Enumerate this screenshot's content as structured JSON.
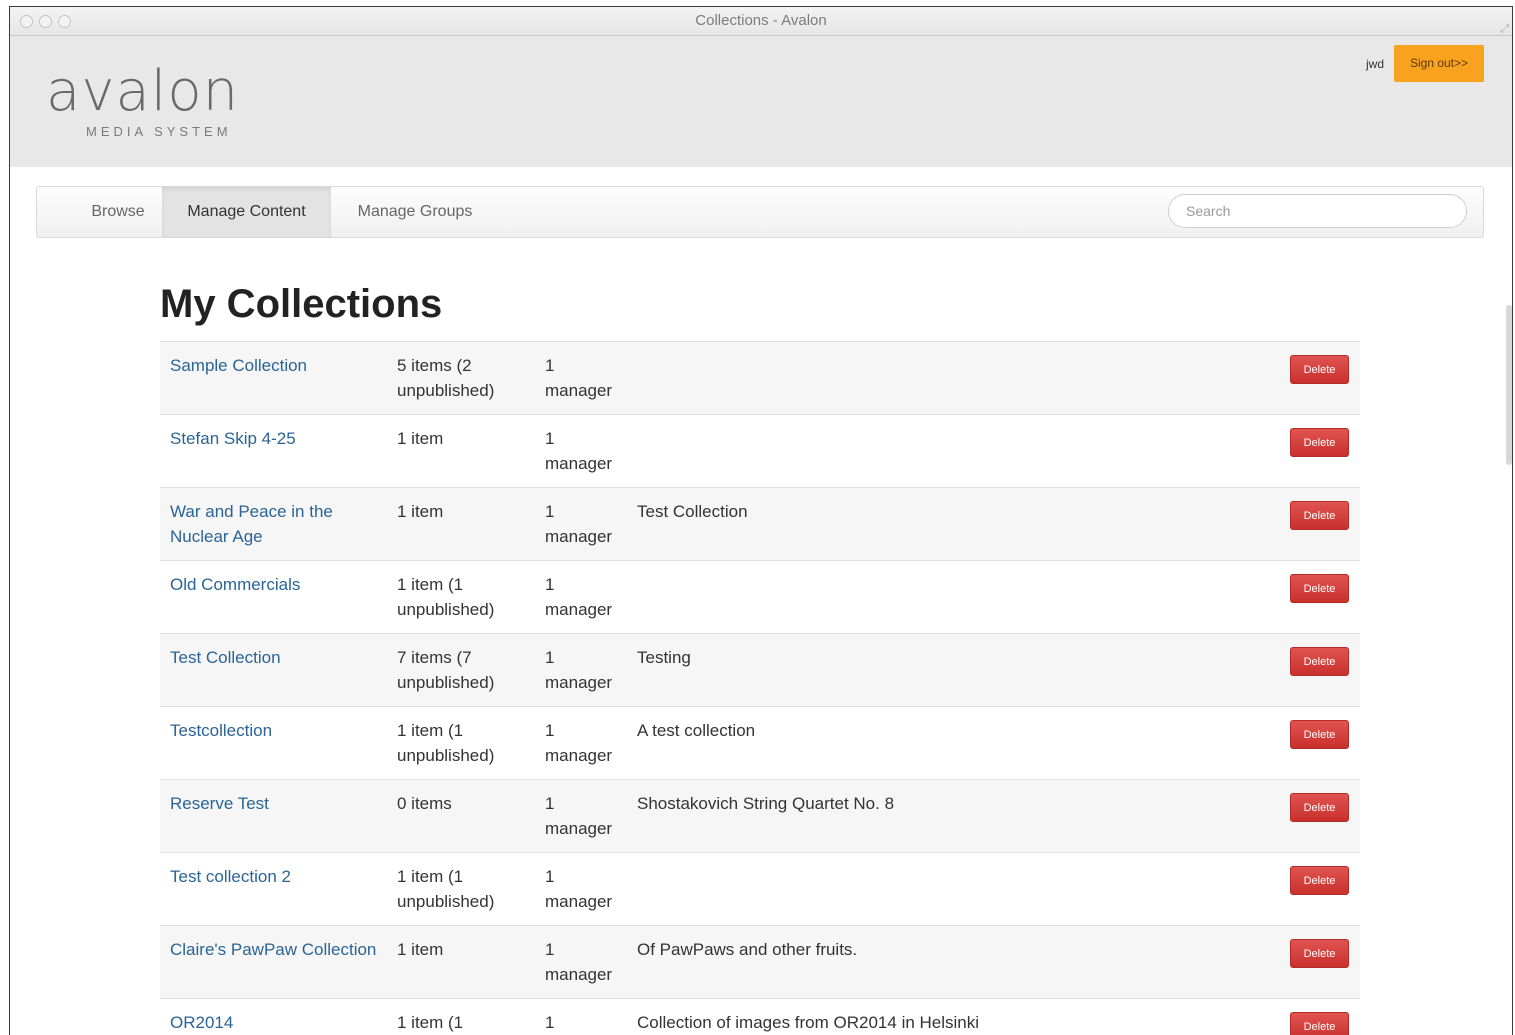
{
  "window": {
    "title": "Collections - Avalon"
  },
  "header": {
    "logo_word": "avalon",
    "logo_sub": "MEDIA SYSTEM",
    "user": "jwd",
    "signout_label": "Sign out>>"
  },
  "nav": {
    "tabs": [
      {
        "label": "Browse",
        "active": false
      },
      {
        "label": "Manage Content",
        "active": true
      },
      {
        "label": "Manage Groups",
        "active": false
      }
    ],
    "search_placeholder": "Search"
  },
  "page": {
    "title": "My Collections"
  },
  "delete_label": "Delete",
  "collections": [
    {
      "name": "Sample Collection",
      "items": "5 items (2 unpublished)",
      "managers": "1 manager",
      "description": ""
    },
    {
      "name": "Stefan Skip 4-25",
      "items": "1 item",
      "managers": "1 manager",
      "description": ""
    },
    {
      "name": "War and Peace in the Nuclear Age",
      "items": "1 item",
      "managers": "1 manager",
      "description": "Test Collection"
    },
    {
      "name": "Old Commercials",
      "items": "1 item (1 unpublished)",
      "managers": "1 manager",
      "description": ""
    },
    {
      "name": "Test Collection",
      "items": "7 items (7 unpublished)",
      "managers": "1 manager",
      "description": "Testing"
    },
    {
      "name": "Testcollection",
      "items": "1 item (1 unpublished)",
      "managers": "1 manager",
      "description": "A test collection"
    },
    {
      "name": "Reserve Test",
      "items": "0 items",
      "managers": "1 manager",
      "description": "Shostakovich String Quartet No. 8"
    },
    {
      "name": "Test collection 2",
      "items": "1 item (1 unpublished)",
      "managers": "1 manager",
      "description": ""
    },
    {
      "name": "Claire's PawPaw Collection",
      "items": "1 item",
      "managers": "1 manager",
      "description": "Of PawPaws and other fruits."
    },
    {
      "name": "OR2014",
      "items": "1 item (1",
      "managers": "1",
      "description": "Collection of images from OR2014 in Helsinki"
    }
  ],
  "colors": {
    "link": "#2a6496",
    "delete": "#d9534f",
    "signout": "#f8a21f",
    "header_bg": "#e8e8e8"
  }
}
